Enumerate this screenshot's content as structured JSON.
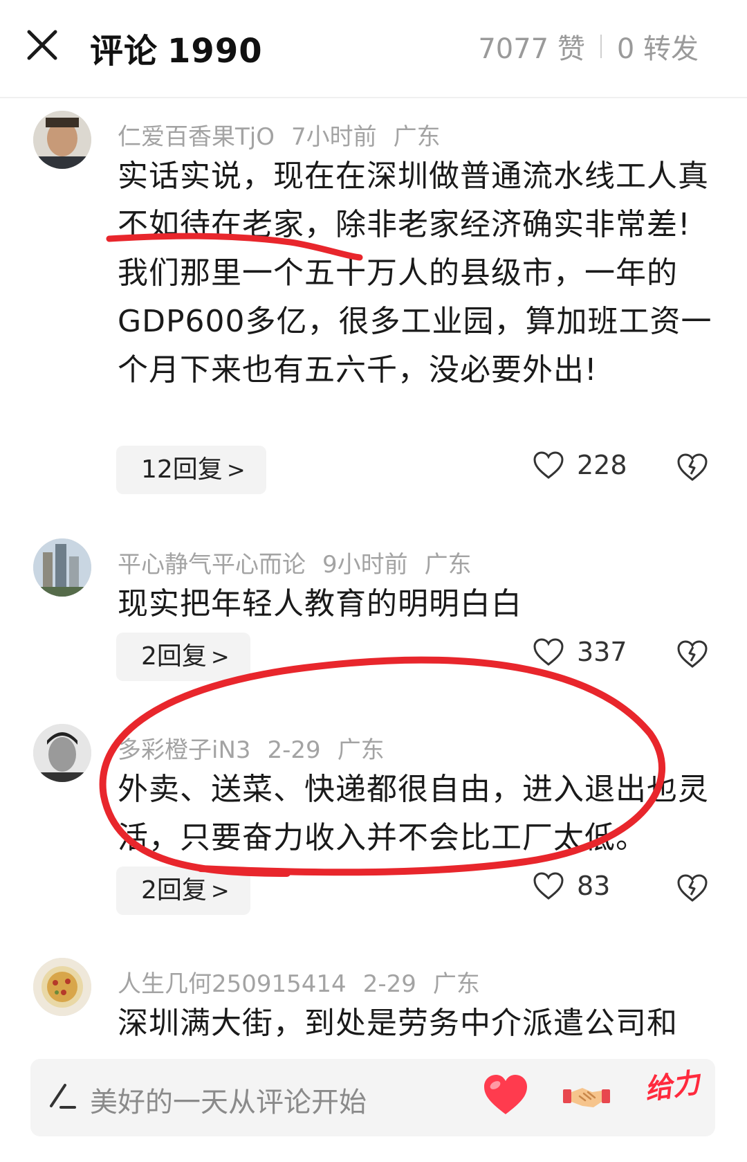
{
  "header": {
    "title": "评论",
    "count": "1990",
    "likes": "7077 赞",
    "shares": "0 转发"
  },
  "comments": [
    {
      "user": "仁爱百香果TjO",
      "time": "7小时前",
      "location": "广东",
      "text": "实话实说，现在在深圳做普通流水线工人真不如待在老家，除非老家经济确实非常差!我们那里一个五十万人的县级市，一年的GDP600多亿，很多工业园，算加班工资一个月下来也有五六千，没必要外出!",
      "replies": "12回复",
      "likes": "228"
    },
    {
      "user": "平心静气平心而论",
      "time": "9小时前",
      "location": "广东",
      "text": "现实把年轻人教育的明明白白",
      "replies": "2回复",
      "likes": "337"
    },
    {
      "user": "多彩橙子iN3",
      "time": "2-29",
      "location": "广东",
      "text": "外卖、送菜、快递都很自由，进入退出也灵活，只要奋力收入并不会比工厂太低。",
      "replies": "2回复",
      "likes": "83"
    },
    {
      "user": "人生几何250915414",
      "time": "2-29",
      "location": "广东",
      "text": "深圳满大街，到处是劳务中介派遣公司和"
    }
  ],
  "bottom_bar": {
    "placeholder": "美好的一天从评论开始",
    "sticker_text": "给力"
  },
  "colors": {
    "annotation_red": "#e8262c",
    "meta_gray": "#a3a3a3",
    "like_heart_red": "#ff3b4e"
  },
  "icons": {
    "close": "close-icon",
    "like": "heart-outline-icon",
    "dislike": "broken-heart-icon",
    "pencil": "pencil-icon",
    "heart_reaction": "red-heart-icon",
    "handshake_reaction": "handshake-icon"
  }
}
